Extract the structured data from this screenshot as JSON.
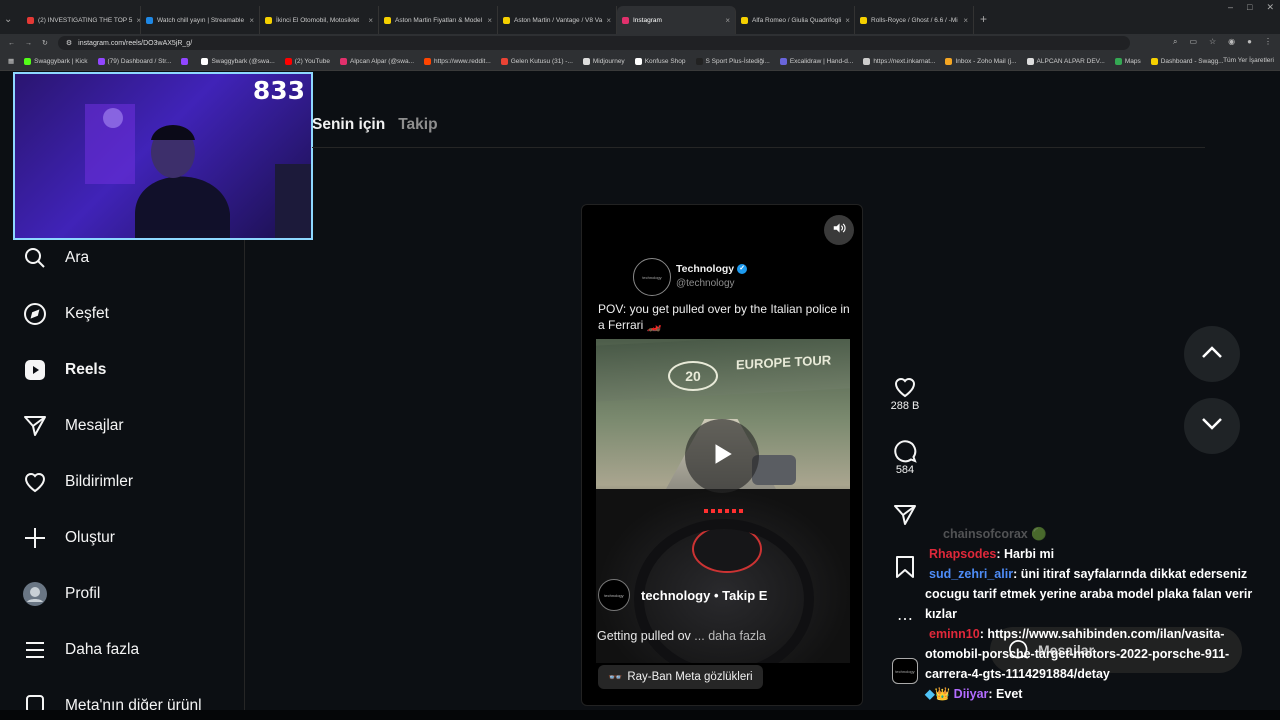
{
  "browser": {
    "tabs": [
      {
        "title": "(2) INVESTIGATING THE TOP 5",
        "color": "#e53935",
        "active": false
      },
      {
        "title": "Watch chill yayın | Streamable",
        "color": "#1e88e5",
        "active": false
      },
      {
        "title": "İkinci El Otomobil, Motosiklet",
        "color": "#f5d000",
        "active": false
      },
      {
        "title": "Aston Martin Fiyatları & Model",
        "color": "#f5d000",
        "active": false
      },
      {
        "title": "Aston Martin / Vantage / V8 Va",
        "color": "#f5d000",
        "active": false
      },
      {
        "title": "Instagram",
        "color": "#e1306c",
        "active": true
      },
      {
        "title": "Alfa Romeo / Giulia Quadrifogli",
        "color": "#f5d000",
        "active": false
      },
      {
        "title": "Rolls-Royce / Ghost / 6.6 / -Mi",
        "color": "#f5d000",
        "active": false
      }
    ],
    "url": "instagram.com/reels/DO3wAX5jR_g/",
    "bookmarks": [
      {
        "label": "Swaggybark | Kick",
        "color": "#53fc18"
      },
      {
        "label": "(79) Dashboard / Str...",
        "color": "#9146ff"
      },
      {
        "label": "",
        "color": "#9146ff"
      },
      {
        "label": "Swaggybark (@swa...",
        "color": "#ffffff"
      },
      {
        "label": "(2) YouTube",
        "color": "#ff0000"
      },
      {
        "label": "Alpcan Alpar (@swa...",
        "color": "#e1306c"
      },
      {
        "label": "https://www.reddit...",
        "color": "#ff4500"
      },
      {
        "label": "Gelen Kutusu (31) -...",
        "color": "#ea4335"
      },
      {
        "label": "Midjourney",
        "color": "#dddddd"
      },
      {
        "label": "Konfuse Shop",
        "color": "#ffffff"
      },
      {
        "label": "S Sport Plus-İstediği...",
        "color": "#222222"
      },
      {
        "label": "Excalidraw | Hand-d...",
        "color": "#6965db"
      },
      {
        "label": "https://next.inkarnat...",
        "color": "#cccccc"
      },
      {
        "label": "Inbox - Zoho Mail (j...",
        "color": "#f5a623"
      },
      {
        "label": "ALPCAN ALPAR DEV...",
        "color": "#dddddd"
      },
      {
        "label": "Maps",
        "color": "#34a853"
      },
      {
        "label": "Dashboard - Swagg...",
        "color": "#f5d000"
      }
    ],
    "bookmarks_right": "Tüm Yer İşaretleri"
  },
  "webcam": {
    "counter": "833"
  },
  "sidebar": {
    "items": [
      {
        "label": "Ara",
        "icon": "search-icon"
      },
      {
        "label": "Keşfet",
        "icon": "explore-icon"
      },
      {
        "label": "Reels",
        "icon": "reels-icon"
      },
      {
        "label": "Mesajlar",
        "icon": "messages-icon"
      },
      {
        "label": "Bildirimler",
        "icon": "heart-icon"
      },
      {
        "label": "Oluştur",
        "icon": "plus-icon"
      },
      {
        "label": "Profil",
        "icon": "profile-avatar"
      },
      {
        "label": "Daha fazla",
        "icon": "menu-icon"
      },
      {
        "label": "Meta'nın diğer ürünl",
        "icon": "meta-icon"
      }
    ]
  },
  "feed_tabs": {
    "active": "Senin için",
    "inactive": "Takip"
  },
  "reel": {
    "tweet": {
      "name": "Technology",
      "handle": "@technology",
      "avatar_text": "technology",
      "text": "POV: you get pulled over by the Italian police in a Ferrari 🏎️"
    },
    "video_banner": "EUROPE TOUR",
    "video_badge": "20",
    "overlay_user": "technology",
    "overlay_follow": "Takip E",
    "overlay_caption": "Getting pulled ov",
    "overlay_more": "... daha fazla",
    "rayban_label": "Ray-Ban Meta gözlükleri"
  },
  "actions": {
    "likes": "288 B",
    "comments": "584"
  },
  "chat": [
    {
      "user": "chainsofcorax",
      "user_color": "#8a8a8a",
      "msg": "",
      "badge": "🟢"
    },
    {
      "user": "Rhapsodes",
      "user_color": "#e0283a",
      "msg": ": Harbi mi"
    },
    {
      "user": "sud_zehri_alir",
      "user_color": "#4e8cf7",
      "msg": ": üni itiraf sayfalarında dikkat ederseniz cocugu tarif etmek yerine araba model plaka falan verir kızlar"
    },
    {
      "user": "eminn10",
      "user_color": "#e0283a",
      "msg": ": https://www.sahibinden.com/ilan/vasita-otomobil-porsche-target-motors-2022-porsche-911-carrera-4-gts-1114291884/detay"
    },
    {
      "user": "Diiyar",
      "user_color": "#b36cff",
      "msg": ": Evet"
    }
  ],
  "messages_pill": "Mesajlar"
}
